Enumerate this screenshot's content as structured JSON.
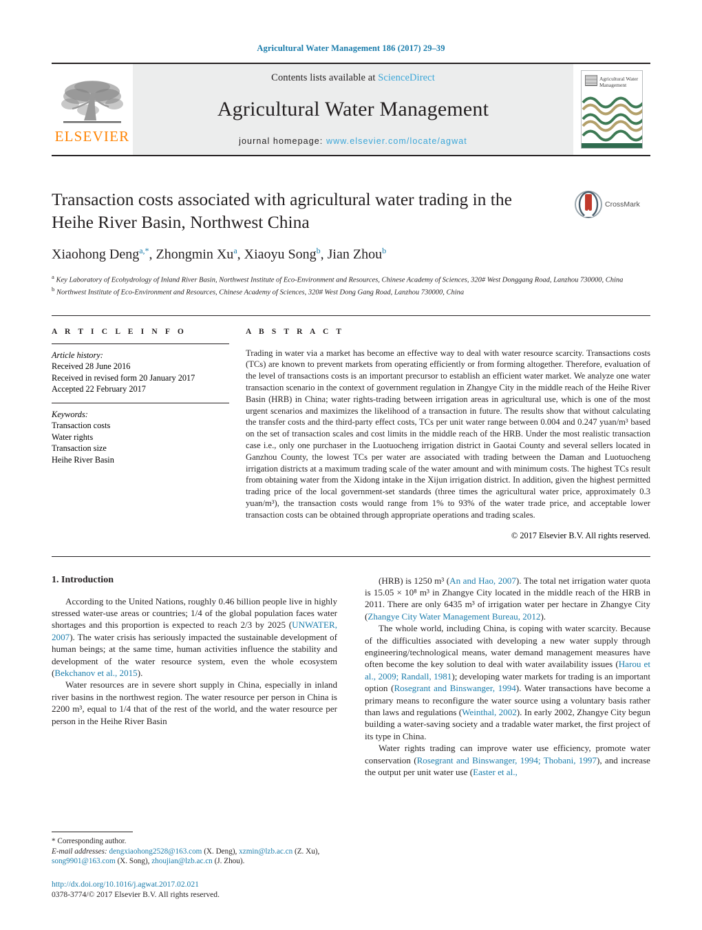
{
  "running_head": "Agricultural Water Management 186 (2017) 29–39",
  "masthead": {
    "contents_prefix": "Contents lists available at ",
    "sciencedirect": "ScienceDirect",
    "journal_name": "Agricultural Water Management",
    "homepage_label": "journal homepage: ",
    "homepage_url": "www.elsevier.com/locate/agwat",
    "publisher": "ELSEVIER",
    "cover_title": "Agricultural Water Management",
    "colors": {
      "link_blue": "#3aa6d8",
      "header_blue": "#1a7cab",
      "elsevier_orange": "#ff8200",
      "masthead_grey": "#eceded",
      "cover_green": "#2f6b4f",
      "cover_tan": "#b3a06a",
      "cover_red": "#c0392b"
    }
  },
  "article": {
    "title": "Transaction costs associated with agricultural water trading in the Heihe River Basin, Northwest China",
    "authors_html": "Xiaohong Deng<sup>a,*</sup>, Zhongmin Xu<sup>a</sup>, Xiaoyu Song<sup>b</sup>, Jian Zhou<sup>b</sup>",
    "crossmark_label": "CrossMark",
    "affiliation_a": "Key Laboratory of Ecohydrology of Inland River Basin, Northwest Institute of Eco-Environment and Resources, Chinese Academy of Sciences, 320# West Donggang Road, Lanzhou 730000, China",
    "affiliation_b": "Northwest Institute of Eco-Environment and Resources, Chinese Academy of Sciences, 320# West Dong Gang Road, Lanzhou 730000, China"
  },
  "article_info": {
    "heading": "A R T I C L E   I N F O",
    "history_label": "Article history:",
    "history": [
      "Received 28 June 2016",
      "Received in revised form 20 January 2017",
      "Accepted 22 February 2017"
    ],
    "keywords_label": "Keywords:",
    "keywords": [
      "Transaction costs",
      "Water rights",
      "Transaction size",
      "Heihe River Basin"
    ]
  },
  "abstract": {
    "heading": "A B S T R A C T",
    "text": "Trading in water via a market has become an effective way to deal with water resource scarcity. Transactions costs (TCs) are known to prevent markets from operating efficiently or from forming altogether. Therefore, evaluation of the level of transactions costs is an important precursor to establish an efficient water market. We analyze one water transaction scenario in the context of government regulation in Zhangye City in the middle reach of the Heihe River Basin (HRB) in China; water rights-trading between irrigation areas in agricultural use, which is one of the most urgent scenarios and maximizes the likelihood of a transaction in future. The results show that without calculating the transfer costs and the third-party effect costs, TCs per unit water range between 0.004 and 0.247 yuan/m³ based on the set of transaction scales and cost limits in the middle reach of the HRB. Under the most realistic transaction case i.e., only one purchaser in the Luotuocheng irrigation district in Gaotai County and several sellers located in Ganzhou County, the lowest TCs per water are associated with trading between the Daman and Luotuocheng irrigation districts at a maximum trading scale of the water amount and with minimum costs. The highest TCs result from obtaining water from the Xidong intake in the Xijun irrigation district. In addition, given the highest permitted trading price of the local government-set standards (three times the agricultural water price, approximately 0.3 yuan/m³), the transaction costs would range from 1% to 93% of the water trade price, and acceptable lower transaction costs can be obtained through appropriate operations and trading scales.",
    "copyright": "© 2017 Elsevier B.V. All rights reserved."
  },
  "body": {
    "section_heading": "1.  Introduction",
    "left_paragraphs": [
      {
        "segments": [
          {
            "t": "According to the United Nations, roughly 0.46 billion people live in highly stressed water-use areas or countries; 1/4 of the global population faces water shortages and this proportion is expected to reach 2/3 by 2025 ("
          },
          {
            "t": "UNWATER, 2007",
            "cite": true
          },
          {
            "t": "). The water crisis has seriously impacted the sustainable development of human beings; at the same time, human activities influence the stability and development of the water resource system, even the whole ecosystem ("
          },
          {
            "t": "Bekchanov et al., 2015",
            "cite": true
          },
          {
            "t": ")."
          }
        ]
      },
      {
        "segments": [
          {
            "t": "Water resources are in severe short supply in China, especially in inland river basins in the northwest region. The water resource per person in China is 2200 m³, equal to 1/4 that of the rest of the world, and the water resource per person in the Heihe River Basin"
          }
        ]
      }
    ],
    "right_paragraphs": [
      {
        "segments": [
          {
            "t": "(HRB) is 1250 m³ ("
          },
          {
            "t": "An and Hao, 2007",
            "cite": true
          },
          {
            "t": "). The total net irrigation water quota is 15.05 × 10⁸ m³ in Zhangye City located in the middle reach of the HRB in 2011. There are only 6435 m³ of irrigation water per hectare in Zhangye City ("
          },
          {
            "t": "Zhangye City Water Management Bureau, 2012",
            "cite": true
          },
          {
            "t": ")."
          }
        ]
      },
      {
        "segments": [
          {
            "t": "The whole world, including China, is coping with water scarcity. Because of the difficulties associated with developing a new water supply through engineering/technological means, water demand management measures have often become the key solution to deal with water availability issues ("
          },
          {
            "t": "Harou et al., 2009; Randall, 1981",
            "cite": true
          },
          {
            "t": "); developing water markets for trading is an important option ("
          },
          {
            "t": "Rosegrant and Binswanger, 1994",
            "cite": true
          },
          {
            "t": "). Water transactions have become a primary means to reconfigure the water source using a voluntary basis rather than laws and regulations ("
          },
          {
            "t": "Weinthal, 2002",
            "cite": true
          },
          {
            "t": "). In early 2002, Zhangye City begun building a water-saving society and a tradable water market, the first project of its type in China."
          }
        ]
      },
      {
        "segments": [
          {
            "t": "Water rights trading can improve water use efficiency, promote water conservation ("
          },
          {
            "t": "Rosegrant and Binswanger, 1994; Thobani, 1997",
            "cite": true
          },
          {
            "t": "), and increase the output per unit water use ("
          },
          {
            "t": "Easter et al.,",
            "cite": true
          }
        ]
      }
    ]
  },
  "footnotes": {
    "corresponding": "*  Corresponding author.",
    "email_label": "E-mail addresses:",
    "emails": [
      {
        "addr": "dengxiaohong2528@163.com",
        "who": " (X. Deng), "
      },
      {
        "addr": "xzmin@lzb.ac.cn",
        "who": " (Z. Xu), "
      },
      {
        "addr": "song9901@163.com",
        "who": " (X. Song), "
      },
      {
        "addr": "zhoujian@lzb.ac.cn",
        "who": " (J. Zhou)."
      }
    ],
    "doi": "http://dx.doi.org/10.1016/j.agwat.2017.02.021",
    "issn": "0378-3774/© 2017 Elsevier B.V. All rights reserved."
  }
}
